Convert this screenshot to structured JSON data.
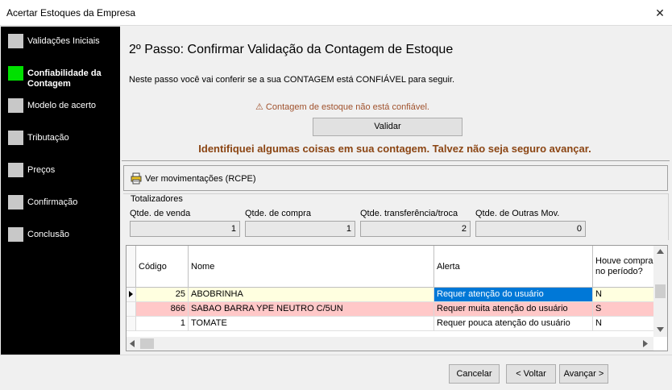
{
  "window": {
    "title": "Acertar Estoques da Empresa",
    "close_icon": "✕"
  },
  "steps": [
    {
      "label": "Validações Iniciais",
      "active": false
    },
    {
      "label": "Confiabilidade da Contagem",
      "active": true
    },
    {
      "label": "Modelo de acerto",
      "active": false
    },
    {
      "label": "Tributação",
      "active": false
    },
    {
      "label": "Preços",
      "active": false
    },
    {
      "label": "Confirmação",
      "active": false
    },
    {
      "label": "Conclusão",
      "active": false
    }
  ],
  "main": {
    "title": "2º Passo: Confirmar Validação da Contagem de Estoque",
    "description": "Neste passo você vai conferir se a sua CONTAGEM está CONFIÁVEL para seguir.",
    "warning": "⚠ Contagem de estoque não está confiável.",
    "validate_button": "Validar",
    "alert": "Identifiquei algumas coisas em sua contagem. Talvez não seja seguro avançar.",
    "rcpe_button": "Ver movimentações (RCPE)"
  },
  "totals": {
    "title": "Totalizadores",
    "fields": [
      {
        "label": "Qtde. de venda",
        "value": "1"
      },
      {
        "label": "Qtde. de compra",
        "value": "1"
      },
      {
        "label": "Qtde. transferência/troca",
        "value": "2"
      },
      {
        "label": "Qtde. de Outras Mov.",
        "value": "0"
      }
    ]
  },
  "grid": {
    "columns": [
      "Código",
      "Nome",
      "Alerta",
      "Houve compra no período?"
    ],
    "rows": [
      {
        "codigo": "25",
        "nome": "ABOBRINHA",
        "alerta": "Requer atenção do usuário",
        "compra": "N",
        "bg": "#ffffe0",
        "selected": true
      },
      {
        "codigo": "866",
        "nome": "SABAO BARRA YPE NEUTRO C/5UN",
        "alerta": "Requer muita atenção do usuário",
        "compra": "S",
        "bg": "#ffc8c8",
        "selected": false
      },
      {
        "codigo": "1",
        "nome": "TOMATE",
        "alerta": "Requer pouca atenção do usuário",
        "compra": "N",
        "bg": "#ffffff",
        "selected": false
      }
    ]
  },
  "footer": {
    "cancel": "Cancelar",
    "back": "< Voltar",
    "next": "Avançar >"
  },
  "colors": {
    "active_step": "#00e000",
    "alert": "#8b4513",
    "selection": "#0078d7"
  }
}
